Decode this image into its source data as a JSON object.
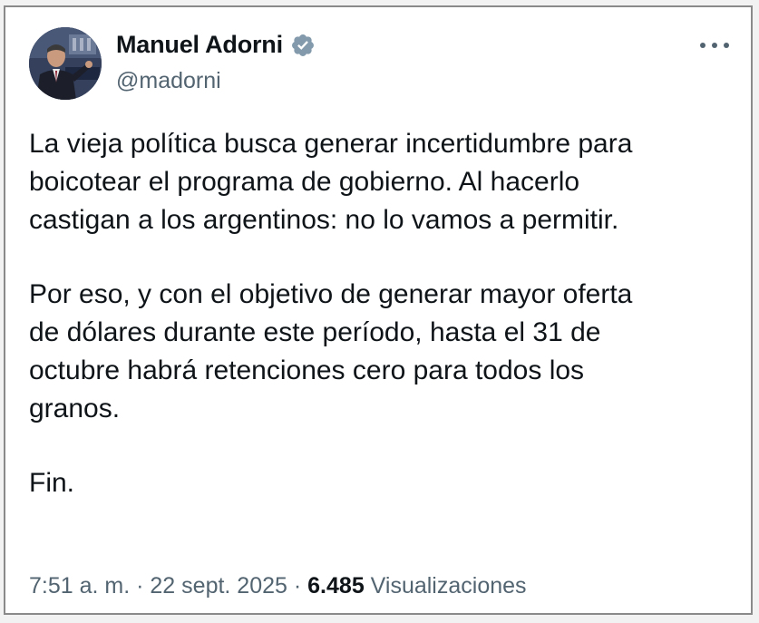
{
  "tweet": {
    "author": {
      "display_name": "Manuel Adorni",
      "handle": "@madorni",
      "verified_icon": "verified-badge-icon"
    },
    "paragraphs": [
      "La vieja política busca generar incertidumbre para\nboicotear el programa de gobierno. Al hacerlo\ncastigan a los argentinos: no lo vamos a permitir.",
      "Por eso, y con el objetivo de generar mayor oferta\nde dólares durante este período, hasta el 31 de\noctubre habrá retenciones cero para todos los\ngranos.",
      "Fin."
    ],
    "time": "7:51 a. m.",
    "separator": "·",
    "date": "22 sept. 2025",
    "views_count": "6.485",
    "views_label": "Visualizaciones"
  },
  "colors": {
    "text_primary": "#0f1419",
    "text_secondary": "#536471",
    "verified_blue": "#829aab",
    "card_border": "#8a8a8a"
  },
  "icons": {
    "more": "more-horizontal-icon",
    "verified": "verified-badge-icon"
  }
}
